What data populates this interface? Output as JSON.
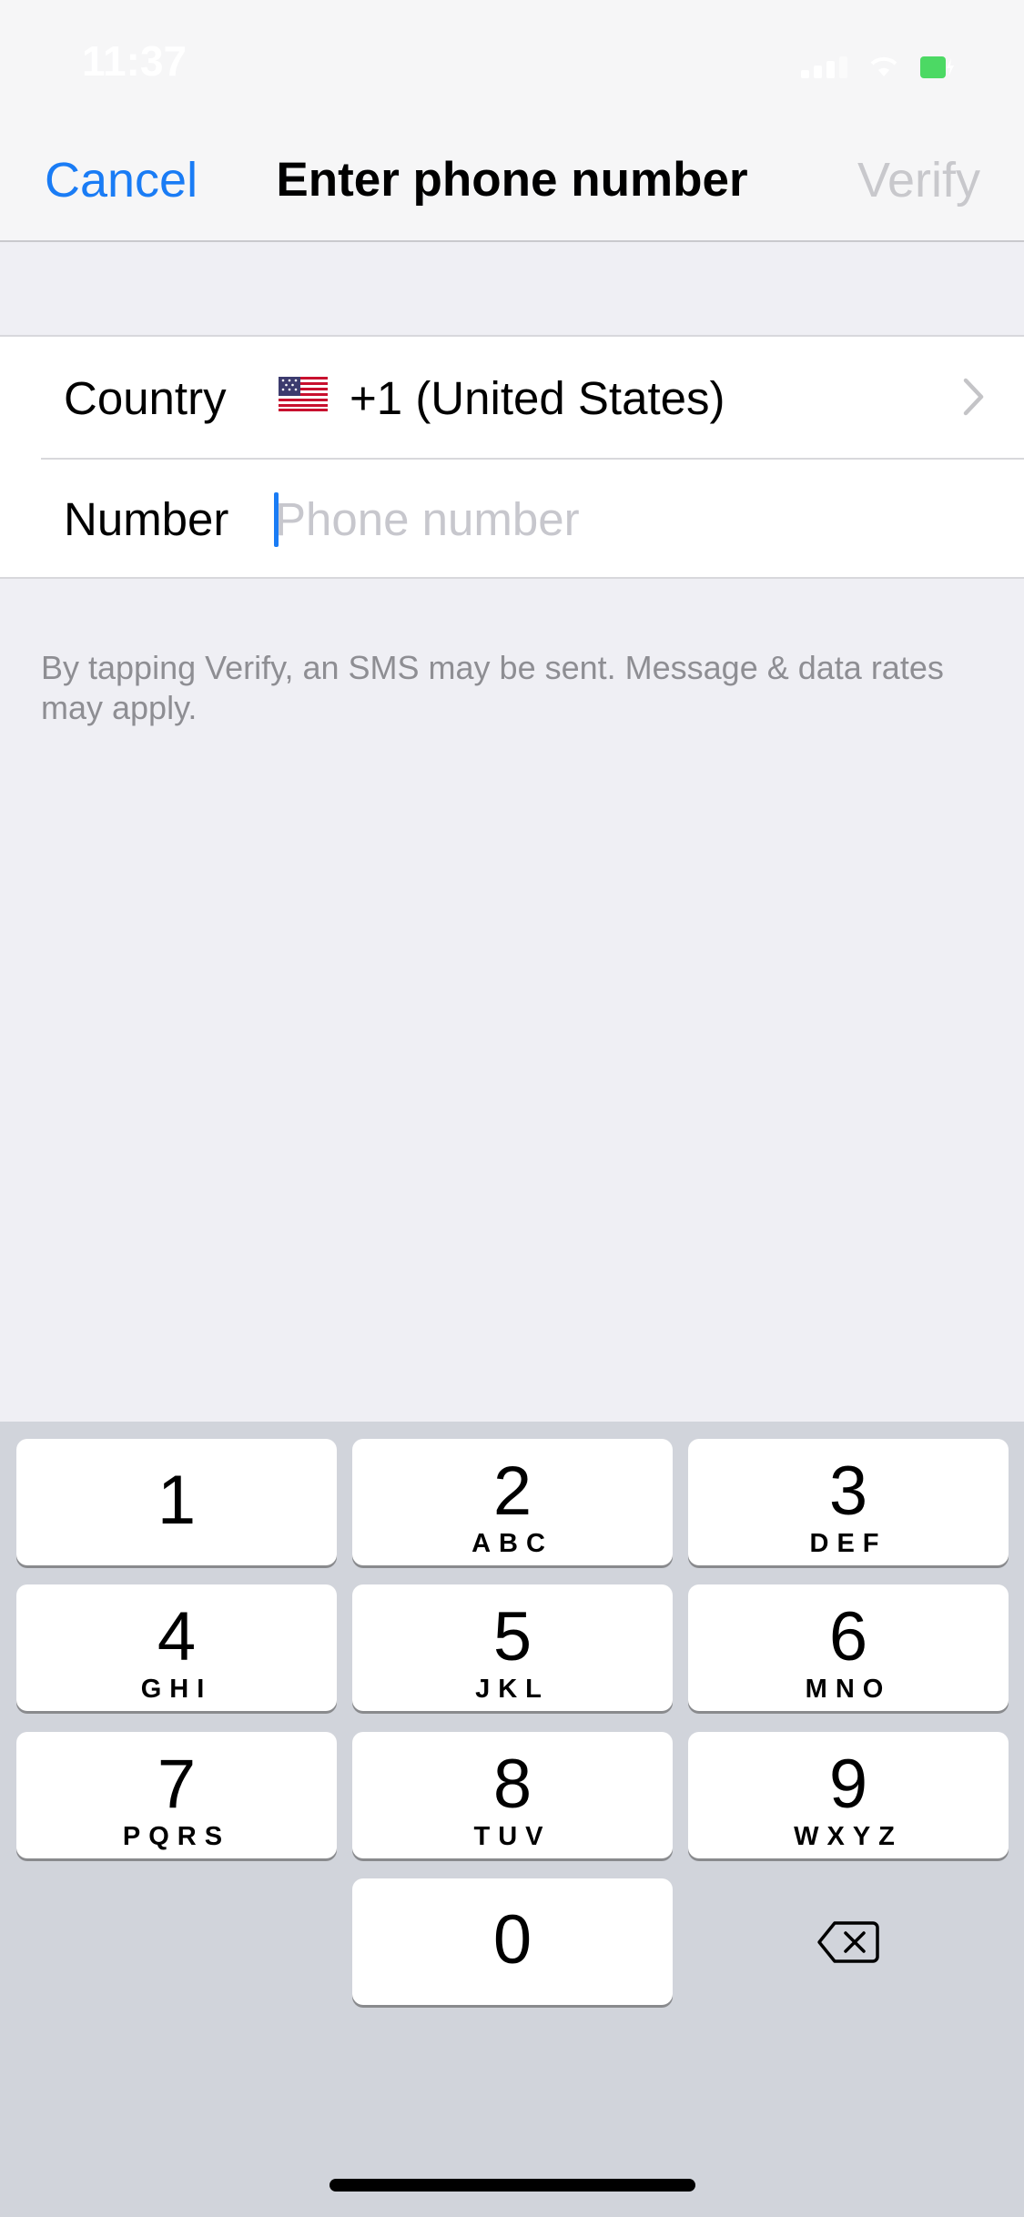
{
  "status_bar": {
    "time": "11:37",
    "icons": [
      "signal-icon",
      "wifi-icon",
      "battery-charging-icon"
    ]
  },
  "nav": {
    "cancel_label": "Cancel",
    "title": "Enter phone number",
    "verify_label": "Verify",
    "accent_color": "#1a7cf5",
    "disabled_color": "#c8c8cc"
  },
  "form": {
    "country_label": "Country",
    "country_flag": "flag-us-icon",
    "country_value": "+1 (United States)",
    "number_label": "Number",
    "number_value": "",
    "number_placeholder": "Phone number"
  },
  "disclaimer": "By tapping Verify, an SMS may be sent. Message & data rates may apply.",
  "keypad": {
    "keys": [
      {
        "digit": "1",
        "letters": ""
      },
      {
        "digit": "2",
        "letters": "ABC"
      },
      {
        "digit": "3",
        "letters": "DEF"
      },
      {
        "digit": "4",
        "letters": "GHI"
      },
      {
        "digit": "5",
        "letters": "JKL"
      },
      {
        "digit": "6",
        "letters": "MNO"
      },
      {
        "digit": "7",
        "letters": "PQRS"
      },
      {
        "digit": "8",
        "letters": "TUV"
      },
      {
        "digit": "9",
        "letters": "WXYZ"
      },
      {
        "digit": "0",
        "letters": ""
      }
    ],
    "delete_icon": "backspace-icon"
  }
}
